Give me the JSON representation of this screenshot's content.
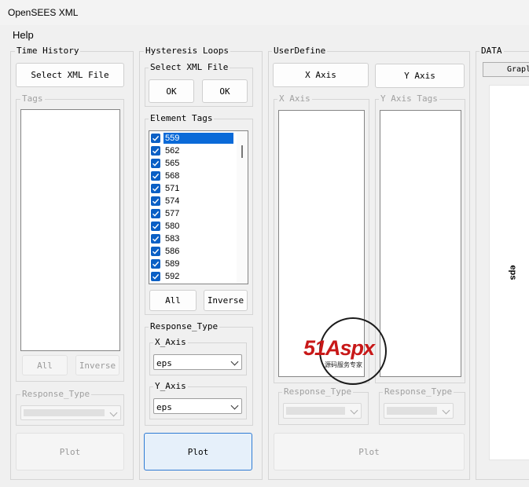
{
  "window": {
    "title": "OpenSEES XML"
  },
  "menu": {
    "help": "Help"
  },
  "time_history": {
    "title": "Time History",
    "select_btn": "Select XML File",
    "tags_label": "Tags",
    "all_btn": "All",
    "inverse_btn": "Inverse",
    "response_label": "Response_Type",
    "plot_btn": "Plot"
  },
  "hysteresis": {
    "title": "Hysteresis Loops",
    "select_label": "Select XML File",
    "ok1": "OK",
    "ok2": "OK",
    "element_tags_label": "Element Tags",
    "element_tags": [
      "559",
      "562",
      "565",
      "568",
      "571",
      "574",
      "577",
      "580",
      "583",
      "586",
      "589",
      "592"
    ],
    "all_btn": "All",
    "inverse_btn": "Inverse",
    "response_label": "Response_Type",
    "x_axis_label": "X_Axis",
    "x_axis_value": "eps",
    "y_axis_label": "Y_Axis",
    "y_axis_value": "eps",
    "plot_btn": "Plot"
  },
  "user_define": {
    "title": "UserDefine",
    "x_axis_btn": "X Axis",
    "y_axis_btn": "Y Axis",
    "x_axis_label": "X Axis",
    "y_axis_tags_label": "Y Axis Tags",
    "response_label_1": "Response_Type",
    "response_label_2": "Response_Type",
    "plot_btn": "Plot"
  },
  "data_panel": {
    "title": "DATA",
    "tab_label": "Grapl",
    "axis_text": "eps"
  },
  "watermark": {
    "brand": "51Aspx",
    "subtitle": "源码服务专家"
  }
}
